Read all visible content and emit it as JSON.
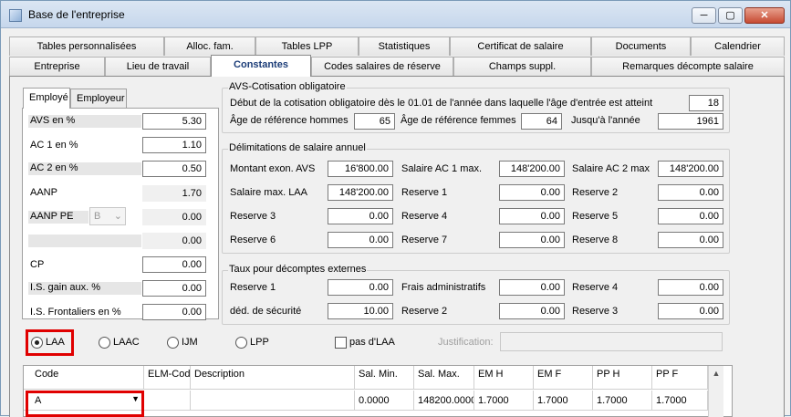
{
  "window": {
    "title": "Base de l'entreprise",
    "min": "─",
    "max": "▢",
    "close": "✕"
  },
  "tabs_row1": [
    "Tables personnalisées",
    "Alloc. fam.",
    "Tables LPP",
    "Statistiques",
    "Certificat de salaire",
    "Documents",
    "Calendrier"
  ],
  "tabs_row2": [
    "Entreprise",
    "Lieu de travail",
    "Constantes",
    "Codes salaires de réserve",
    "Champs suppl.",
    "Remarques décompte salaire"
  ],
  "subtabs": [
    "Employé",
    "Employeur"
  ],
  "employee": {
    "avs": {
      "label": "AVS en %",
      "value": "5.30"
    },
    "ac1": {
      "label": "AC 1 en %",
      "value": "1.10"
    },
    "ac2": {
      "label": "AC 2 en %",
      "value": "0.50"
    },
    "aanp": {
      "label": "AANP",
      "value": "1.70"
    },
    "aanppe": {
      "label": "AANP PE",
      "select": "B",
      "value": "0.00"
    },
    "blank": {
      "value": "0.00"
    },
    "cp": {
      "label": "CP",
      "value": "0.00"
    },
    "is_gain": {
      "label": "I.S. gain aux. %",
      "value": "0.00"
    },
    "is_front": {
      "label": "I.S. Frontaliers en %",
      "value": "0.00"
    }
  },
  "avs_group": {
    "title": "AVS-Cotisation obligatoire",
    "start_text": "Début de la cotisation obligatoire dès le 01.01 de l'année dans laquelle l'âge d'entrée est atteint",
    "start_value": "18",
    "men_label": "Âge de référence hommes",
    "men_value": "65",
    "women_label": "Âge de référence femmes",
    "women_value": "64",
    "until_label": "Jusqu'à l'année",
    "until_value": "1961"
  },
  "salary_group": {
    "title": "Délimitations de salaire annuel",
    "rows": [
      [
        [
          "Montant exon. AVS",
          "16'800.00"
        ],
        [
          "Salaire AC 1 max.",
          "148'200.00"
        ],
        [
          "Salaire AC 2 max",
          "148'200.00"
        ]
      ],
      [
        [
          "Salaire max. LAA",
          "148'200.00"
        ],
        [
          "Reserve 1",
          "0.00"
        ],
        [
          "Reserve 2",
          "0.00"
        ]
      ],
      [
        [
          "Reserve 3",
          "0.00"
        ],
        [
          "Reserve 4",
          "0.00"
        ],
        [
          "Reserve 5",
          "0.00"
        ]
      ],
      [
        [
          "Reserve 6",
          "0.00"
        ],
        [
          "Reserve 7",
          "0.00"
        ],
        [
          "Reserve 8",
          "0.00"
        ]
      ]
    ]
  },
  "rates_group": {
    "title": "Taux pour décomptes externes",
    "rows": [
      [
        [
          "Reserve 1",
          "0.00"
        ],
        [
          "Frais administratifs",
          "0.00"
        ],
        [
          "Reserve 4",
          "0.00"
        ]
      ],
      [
        [
          "déd. de sécurité",
          "10.00"
        ],
        [
          "Reserve 2",
          "0.00"
        ],
        [
          "Reserve 3",
          "0.00"
        ]
      ]
    ]
  },
  "options": {
    "laa": "LAA",
    "laac": "LAAC",
    "ijm": "IJM",
    "lpp": "LPP",
    "pas_laa": "pas d'LAA",
    "justification": "Justification:"
  },
  "table": {
    "headers": [
      "Code",
      "ELM-Cod",
      "Description",
      "Sal. Min.",
      "Sal. Max.",
      "EM H",
      "EM F",
      "PP H",
      "PP F"
    ],
    "row": [
      "A",
      "",
      "",
      "0.0000",
      "148200.0000",
      "1.7000",
      "1.7000",
      "1.7000",
      "1.7000"
    ]
  },
  "colors": {
    "highlight": "#e00000",
    "active_tab_text": "#1c3d78"
  }
}
